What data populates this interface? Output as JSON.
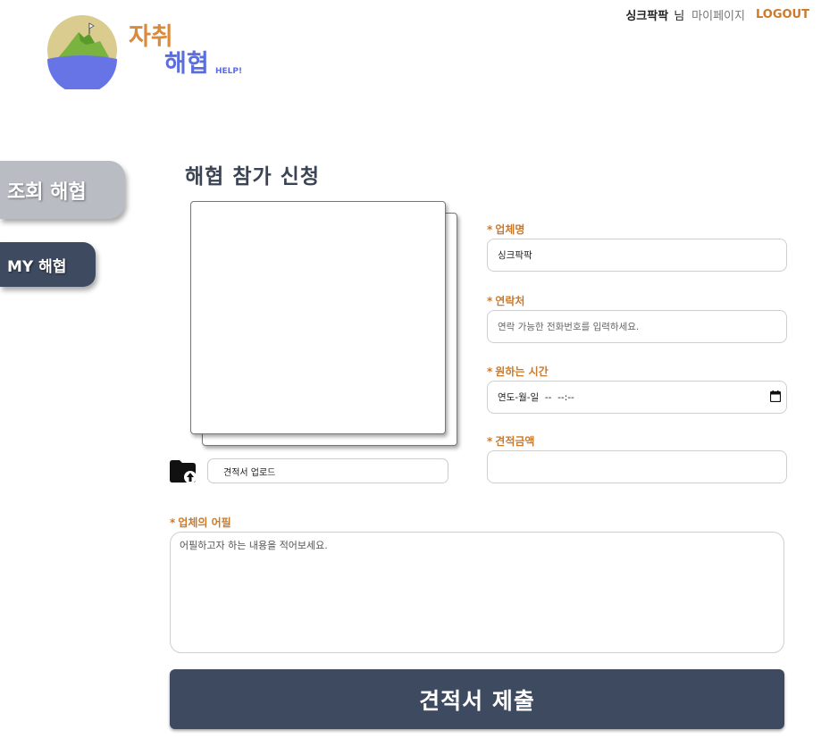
{
  "header": {
    "logo": {
      "text_top": "자취",
      "text_bottom": "해협",
      "text_small": "HELP!"
    },
    "user_name": "싱크팍팍",
    "user_suffix": "님",
    "mypage_label": "마이페이지",
    "logout_label": "LOGOUT"
  },
  "sidebar": {
    "items": [
      {
        "label": "조회 해협"
      },
      {
        "label": "MY 해협"
      }
    ]
  },
  "page_title": "해협 참가 신청",
  "upload": {
    "label": "견적서 업로드"
  },
  "form": {
    "company": {
      "label": "업체명",
      "value": "싱크팍팍"
    },
    "contact": {
      "label": "연락처",
      "placeholder": "연락 가능한 전화번호를 입력하세요."
    },
    "time": {
      "label": "원하는 시간",
      "placeholder": "연도-월-일  --  --:--"
    },
    "price": {
      "label": "견적금액",
      "value": ""
    },
    "appeal": {
      "label": "업체의 어필",
      "placeholder": "어필하고자 하는 내용을 적어보세요."
    }
  },
  "required_mark": "*",
  "submit_label": "견적서 제출",
  "colors": {
    "accent": "#cc7a2a",
    "navy": "#3e4a5f",
    "gray_tab": "#b9bcc3"
  }
}
